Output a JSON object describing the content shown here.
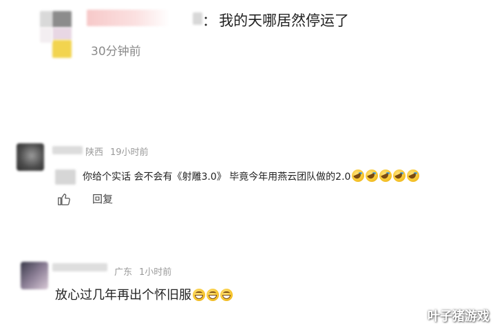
{
  "post": {
    "separator": "：",
    "comment": "我的天哪居然停运了",
    "time": "30分钟前"
  },
  "replies": [
    {
      "location": "陕西",
      "time": "19小时前",
      "text": "你给个实话 会不会有《射雕3.0》 毕竟今年用燕云团队做的2.0",
      "emoji": "crying-emoji",
      "emoji_count": 5,
      "reply_label": "回复"
    },
    {
      "location": "广东",
      "time": "1小时前",
      "text": "放心过几年再出个怀旧服",
      "emoji": "grinning-emoji",
      "emoji_count": 3
    }
  ],
  "watermark": "叶子猪游戏",
  "colors": {
    "text": "#222222",
    "meta": "#9a9a9a",
    "watermark": "#ffffff"
  }
}
